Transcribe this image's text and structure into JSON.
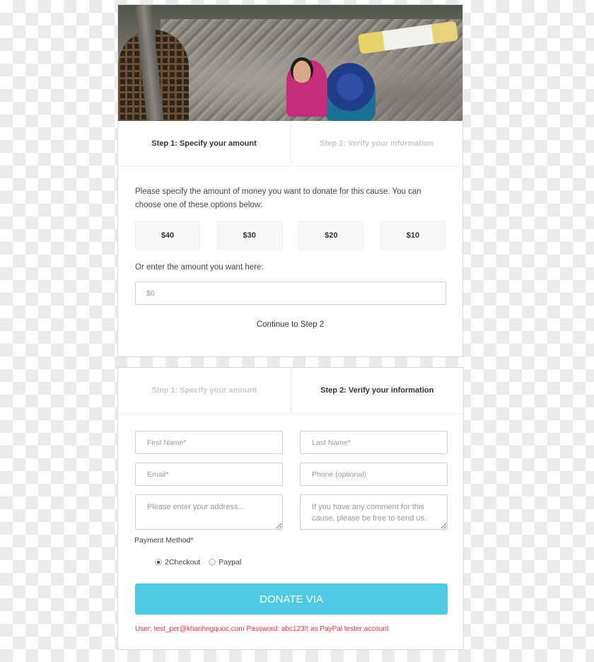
{
  "hero": {
    "image_description": "earthquake-rubble-photo"
  },
  "step1_card": {
    "tabs": [
      {
        "label": "Step 1: Specify your amount",
        "active": true
      },
      {
        "label": "Step 2: Verify your information",
        "active": false
      }
    ],
    "intro": "Please specify the amount of money you want to donate for this cause. You can choose one of these options below:",
    "amount_options": [
      "$40",
      "$30",
      "$20",
      "$10"
    ],
    "custom_label": "Or enter the amount you want here:",
    "custom_amount": {
      "value": "",
      "placeholder": "$0"
    },
    "continue_label": "Continue to Step 2"
  },
  "step2_card": {
    "tabs": [
      {
        "label": "Step 1: Specify your amount",
        "active": false
      },
      {
        "label": "Step 2: Verify your information",
        "active": true
      }
    ],
    "fields": {
      "first_name": {
        "value": "",
        "placeholder": "First Name*"
      },
      "last_name": {
        "value": "",
        "placeholder": "Last Name*"
      },
      "email": {
        "value": "",
        "placeholder": "Email*"
      },
      "phone": {
        "value": "",
        "placeholder": "Phone (optional)"
      },
      "address": {
        "value": "",
        "placeholder": "Please enter your address..."
      },
      "comment": {
        "value": "",
        "placeholder": "If you have any comment for this cause, please be free to send us."
      }
    },
    "payment_method_label": "Payment Method*",
    "payment_options": [
      {
        "label": "2Checkout",
        "checked": true
      },
      {
        "label": "Paypal",
        "checked": false
      }
    ],
    "donate_label": "DONATE VIA",
    "tester_note": "User: test_per@khanhngquoc.com Password: abc123!! as PayPal tester account"
  },
  "colors": {
    "accent": "#4ecae5",
    "note_red": "#e8333a",
    "active_tab_text": "#333333",
    "inactive_tab_text": "#c9c9c9"
  }
}
